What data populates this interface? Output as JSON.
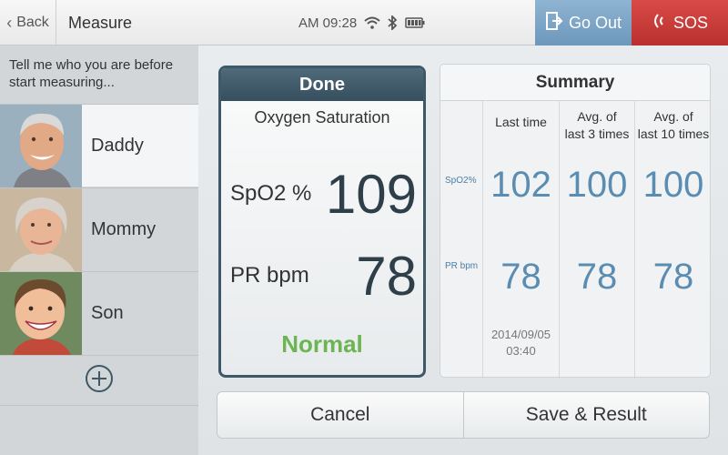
{
  "header": {
    "back_label": "Back",
    "title": "Measure",
    "time": "AM 09:28",
    "status_icons": [
      "wifi-icon",
      "bluetooth-icon",
      "battery-icon"
    ],
    "go_out_label": "Go Out",
    "sos_label": "SOS"
  },
  "sidebar": {
    "prompt": "Tell me who you are before start measuring...",
    "users": [
      {
        "name": "Daddy",
        "selected": true
      },
      {
        "name": "Mommy",
        "selected": false
      },
      {
        "name": "Son",
        "selected": false
      }
    ],
    "add_icon": "plus-circle-icon"
  },
  "result": {
    "status_header": "Done",
    "subtitle": "Oxygen Saturation",
    "spo2_label": "SpO2 %",
    "spo2_value": "109",
    "pr_label": "PR bpm",
    "pr_value": "78",
    "verdict": "Normal"
  },
  "summary": {
    "title": "Summary",
    "row_labels": [
      "SpO2%",
      "PR bpm"
    ],
    "columns": [
      {
        "header": "Last time",
        "spo2": "102",
        "pr": "78",
        "timestamp": "2014/09/05\n03:40"
      },
      {
        "header": "Avg. of\nlast 3 times",
        "spo2": "100",
        "pr": "78"
      },
      {
        "header": "Avg. of\nlast 10 times",
        "spo2": "100",
        "pr": "78"
      }
    ]
  },
  "actions": {
    "cancel_label": "Cancel",
    "save_label": "Save & Result"
  },
  "colors": {
    "header_dark": "#3e5868",
    "normal_green": "#6bb552",
    "value_blue": "#5a8db1",
    "go_out_blue": "#7ea6c8",
    "sos_red": "#c93b39"
  }
}
